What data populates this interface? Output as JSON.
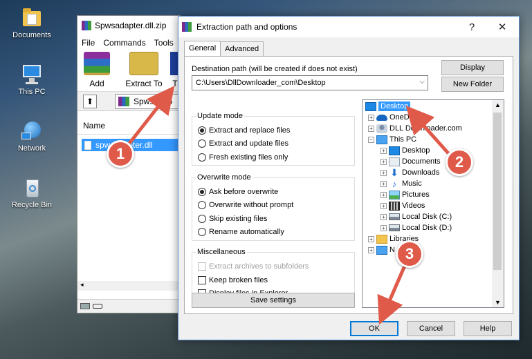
{
  "desktop": {
    "icons": [
      {
        "label": "Documents"
      },
      {
        "label": "This PC"
      },
      {
        "label": "Network"
      },
      {
        "label": "Recycle Bin"
      }
    ]
  },
  "winrar": {
    "title": "Spwsadapter.dll.zip",
    "menu": [
      "File",
      "Commands",
      "Tools"
    ],
    "toolbar": {
      "add": "Add",
      "extract_to": "Extract To",
      "test": "T"
    },
    "path_text": "Spwsadap",
    "column_name": "Name",
    "file": "spwsadapter.dll"
  },
  "dialog": {
    "title": "Extraction path and options",
    "help_glyph": "?",
    "close_glyph": "✕",
    "tabs": [
      "General",
      "Advanced"
    ],
    "dest_label": "Destination path (will be created if does not exist)",
    "dest_value": "C:\\Users\\DllDownloader_com\\Desktop",
    "buttons": {
      "display": "Display",
      "new_folder": "New Folder",
      "save_settings": "Save settings",
      "ok": "OK",
      "cancel": "Cancel",
      "help": "Help"
    },
    "update_mode": {
      "title": "Update mode",
      "options": [
        "Extract and replace files",
        "Extract and update files",
        "Fresh existing files only"
      ],
      "selected": 0
    },
    "overwrite_mode": {
      "title": "Overwrite mode",
      "options": [
        "Ask before overwrite",
        "Overwrite without prompt",
        "Skip existing files",
        "Rename automatically"
      ],
      "selected": 0
    },
    "misc": {
      "title": "Miscellaneous",
      "options": [
        "Extract archives to subfolders",
        "Keep broken files",
        "Display files in Explorer"
      ]
    },
    "tree": {
      "selected": "Desktop",
      "nodes": [
        "Desktop",
        "OneDr",
        "DLL Downloader.com",
        "This PC",
        "Desktop",
        "Documents",
        "Downloads",
        "Music",
        "Pictures",
        "Videos",
        "Local Disk (C:)",
        "Local Disk (D:)",
        "Libraries",
        "N"
      ]
    }
  },
  "callouts": [
    "1",
    "2",
    "3"
  ],
  "colors": {
    "accent": "#0078d7",
    "selection": "#3399ff",
    "callout": "#e05a4a"
  }
}
